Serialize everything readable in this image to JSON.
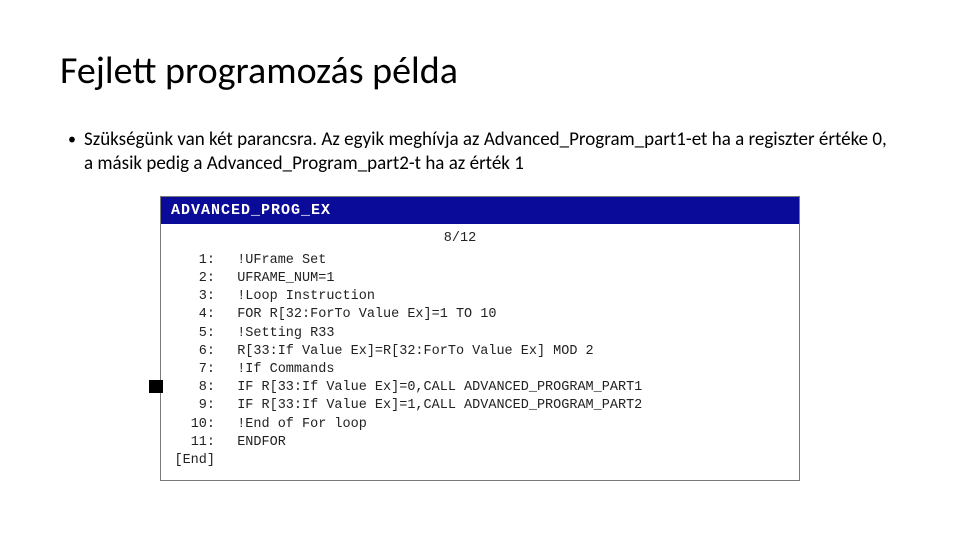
{
  "title": "Fejlett programozás példa",
  "bullet": "Szükségünk van két parancsra. Az egyik meghívja az Advanced_Program_part1-et ha a regiszter értéke 0, a másik pedig a Advanced_Program_part2-t ha az érték 1",
  "editor": {
    "header": "ADVANCED_PROG_EX",
    "counter": "8/12",
    "lines": [
      {
        "no": "1:",
        "code": "!UFrame Set",
        "marked": false
      },
      {
        "no": "2:",
        "code": "UFRAME_NUM=1",
        "marked": false
      },
      {
        "no": "3:",
        "code": "!Loop Instruction",
        "marked": false
      },
      {
        "no": "4:",
        "code": "FOR R[32:ForTo Value Ex]=1 TO 10",
        "marked": false
      },
      {
        "no": "5:",
        "code": "!Setting R33",
        "marked": false
      },
      {
        "no": "6:",
        "code": "R[33:If Value Ex]=R[32:ForTo Value Ex] MOD 2",
        "marked": false
      },
      {
        "no": "7:",
        "code": "!If Commands",
        "marked": false
      },
      {
        "no": "8:",
        "code": "IF R[33:If Value Ex]=0,CALL ADVANCED_PROGRAM_PART1",
        "marked": true
      },
      {
        "no": "9:",
        "code": "IF R[33:If Value Ex]=1,CALL ADVANCED_PROGRAM_PART2",
        "marked": false
      },
      {
        "no": "10:",
        "code": "!End of For loop",
        "marked": false
      },
      {
        "no": "11:",
        "code": "ENDFOR",
        "marked": false
      },
      {
        "no": "[End]",
        "code": "",
        "marked": false
      }
    ]
  }
}
